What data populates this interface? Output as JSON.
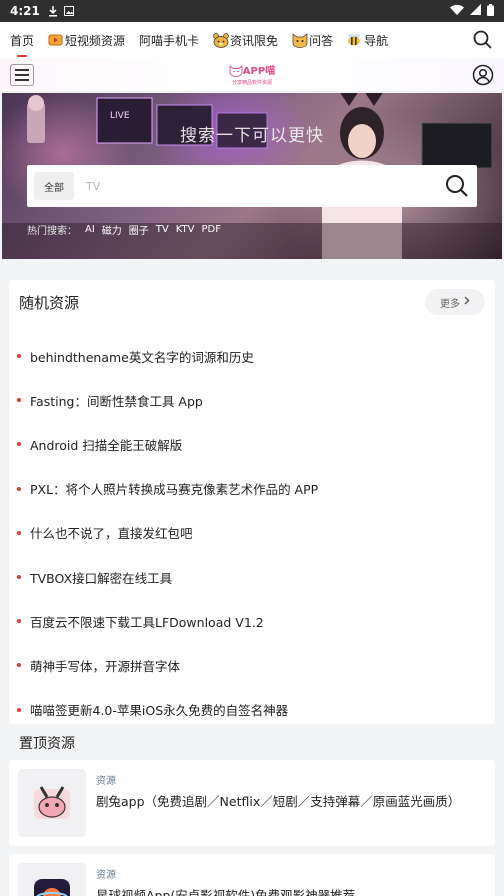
{
  "status_bar": {
    "time": "4:21"
  },
  "top_nav": {
    "items": [
      {
        "label": "首页",
        "active": true
      },
      {
        "label": "短视频资源",
        "icon": "video-icon"
      },
      {
        "label": "阿喵手机卡"
      },
      {
        "label": "资讯限免",
        "icon": "bear-icon"
      },
      {
        "label": "问答",
        "icon": "cat-icon"
      },
      {
        "label": "导航",
        "icon": "bee-icon"
      }
    ]
  },
  "header": {
    "logo_text": "APP喵",
    "logo_sub": "分享精品软件资源"
  },
  "hero": {
    "title": "搜索一下可以更快",
    "search_category": "全部",
    "search_placeholder": "TV",
    "hot_label": "热门搜索：",
    "hot_keywords": [
      "AI",
      "磁力",
      "圈子",
      "TV",
      "KTV",
      "PDF"
    ]
  },
  "random_resources": {
    "title": "随机资源",
    "more_label": "更多",
    "items": [
      "behindthename英文名字的词源和历史",
      "Fasting：间断性禁食工具 App",
      "Android 扫描全能王破解版",
      "PXL：将个人照片转换成马赛克像素艺术作品的 APP",
      "什么也不说了，直接发红包吧",
      "TVBOX接口解密在线工具",
      "百度云不限速下载工具LFDownload V1.2",
      "萌神手写体，开源拼音字体",
      "喵喵签更新4.0-苹果iOS永久免费的自签名神器"
    ]
  },
  "sticky_resources": {
    "title": "置顶资源",
    "items": [
      {
        "category": "资源",
        "title": "剧兔app（免费追剧／Netflix／短剧／支持弹幕／原画蓝光画质）"
      },
      {
        "category": "资源",
        "title": "星球视频App(安卓影视软件)免费观影神器推荐"
      }
    ]
  },
  "colors": {
    "accent": "#e33333",
    "category": "#6a7c99",
    "logo": "#e64a8a"
  }
}
